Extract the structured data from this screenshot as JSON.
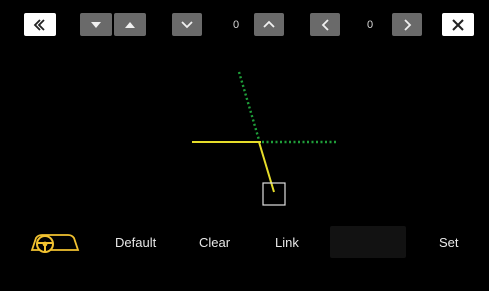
{
  "toolbar": {
    "back_icon": "double-chevron-left-icon",
    "height_down_icon": "triangle-down-icon",
    "height_up_icon": "triangle-up-icon",
    "vertical_down_icon": "chevron-down-icon",
    "vertical_value": "0",
    "vertical_up_icon": "chevron-up-icon",
    "horizontal_left_icon": "chevron-left-icon",
    "horizontal_value": "0",
    "horizontal_right_icon": "chevron-right-icon",
    "close_icon": "close-icon"
  },
  "guide": {
    "dotted_color": "#1f9f3a",
    "solid_color": "#e6dd2a",
    "box_color": "#e0e0e0"
  },
  "bottom_bar": {
    "steering_icon": "steering-wheel-icon",
    "steering_color": "#f2c230",
    "default_label": "Default",
    "clear_label": "Clear",
    "link_label": "Link",
    "blank_label": "",
    "set_label": "Set"
  }
}
